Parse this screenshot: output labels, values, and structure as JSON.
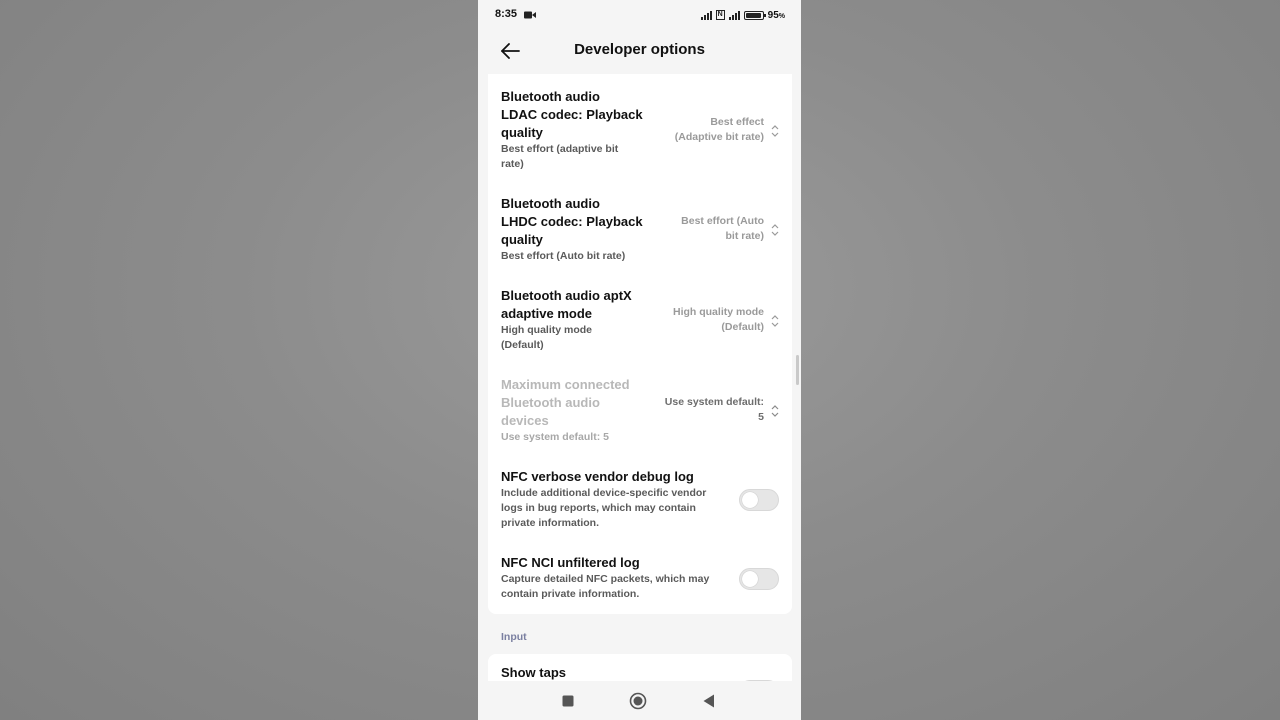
{
  "status_bar": {
    "time": "8:35",
    "battery": "95",
    "battery_unit": "%",
    "icons": [
      "video-camera-icon",
      "signal-icon",
      "nfc-icon",
      "signal-icon",
      "battery-icon"
    ]
  },
  "header": {
    "title": "Developer options",
    "back_icon": "back-arrow-icon"
  },
  "settings": [
    {
      "title": "Bluetooth audio LDAC codec: Playback quality",
      "title_lines": [
        "Bluetooth audio",
        "LDAC codec: Playback",
        "quality"
      ],
      "subtitle_lines": [
        "Best effort (adaptive bit",
        "rate)"
      ],
      "value_lines": [
        "Best effect",
        "(Adaptive bit rate)"
      ],
      "enabled": true
    },
    {
      "title": "Bluetooth audio LHDC codec: Playback quality",
      "title_lines": [
        "Bluetooth audio",
        "LHDC codec: Playback",
        "quality"
      ],
      "subtitle_lines": [
        "Best effort (Auto bit rate)"
      ],
      "value_lines": [
        "Best effort (Auto",
        "bit rate)"
      ],
      "enabled": true
    },
    {
      "title": "Bluetooth audio aptX adaptive mode",
      "title_lines": [
        "Bluetooth audio aptX",
        "adaptive mode"
      ],
      "subtitle_lines": [
        "High quality mode",
        "(Default)"
      ],
      "value_lines": [
        "High quality mode",
        "(Default)"
      ],
      "enabled": true
    },
    {
      "title": "Maximum connected Bluetooth audio devices",
      "title_lines": [
        "Maximum connected",
        "Bluetooth audio",
        "devices"
      ],
      "subtitle_lines": [
        "Use system default: 5"
      ],
      "value_lines": [
        "Use system default:",
        "5"
      ],
      "enabled": false
    }
  ],
  "toggles": [
    {
      "title": "NFC verbose vendor debug log",
      "subtitle_lines": [
        "Include additional device-specific vendor",
        "logs in bug reports, which may contain",
        "private information."
      ],
      "on": false
    },
    {
      "title": "NFC NCI unfiltered log",
      "subtitle_lines": [
        "Capture detailed NFC packets, which may",
        "contain private information."
      ],
      "on": false
    }
  ],
  "section_input": {
    "label": "Input",
    "items": [
      {
        "title": "Show taps",
        "on": false
      }
    ]
  },
  "nav_bar": {
    "buttons": [
      "recents-square-icon",
      "home-circle-icon",
      "back-triangle-icon"
    ]
  },
  "colors": {
    "background": "#f5f5f5",
    "card": "#ffffff",
    "title": "#111111",
    "subtitle": "#5a5a5a",
    "value": "#9a9a9a",
    "disabled": "#b8b8b8",
    "section_label": "#7a7fa0",
    "toggle_off": "#e6e6e6"
  }
}
